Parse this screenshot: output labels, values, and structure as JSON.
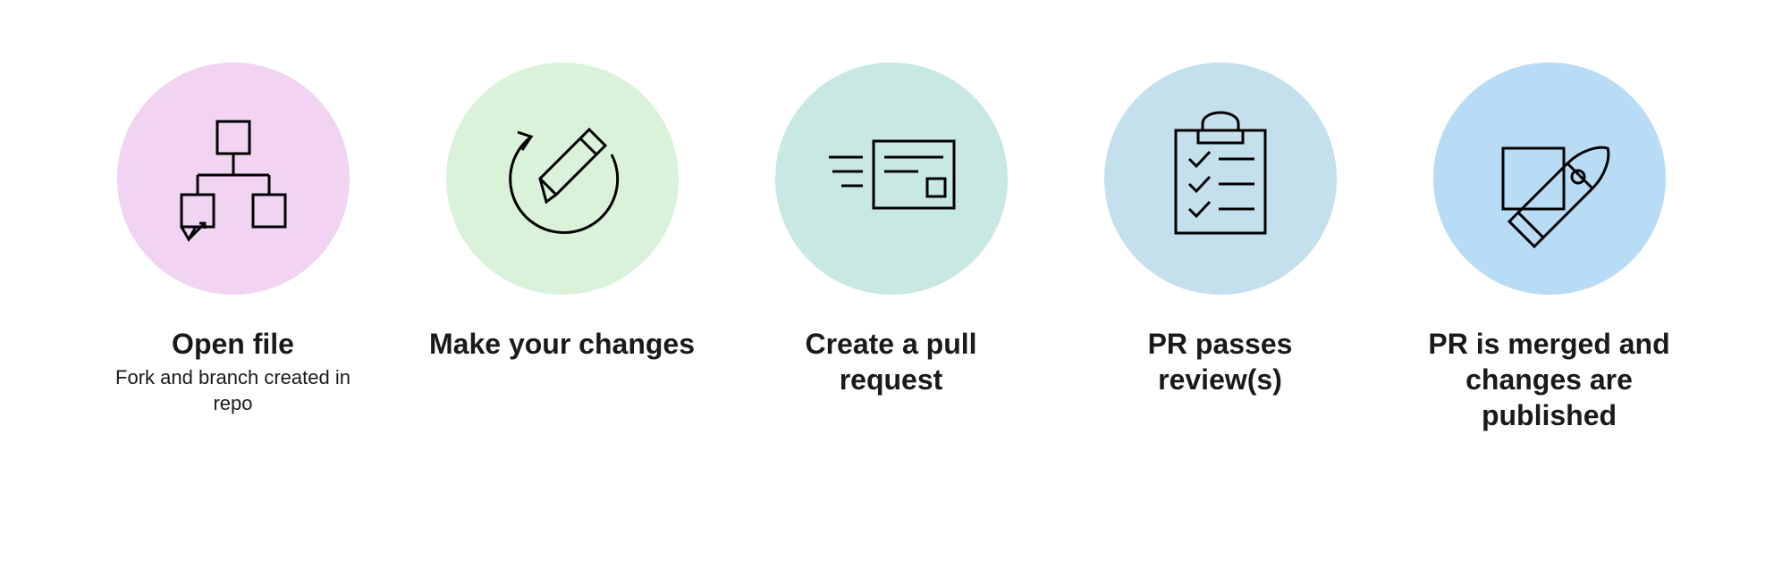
{
  "steps": [
    {
      "title": "Open file",
      "subtitle": "Fork and branch created in repo",
      "color": "#f1d3f2",
      "icon": "fork-tree-icon"
    },
    {
      "title": "Make your changes",
      "subtitle": "",
      "color": "#d9f2d9",
      "icon": "pencil-cycle-icon"
    },
    {
      "title": "Create a pull request",
      "subtitle": "",
      "color": "#c8e8e3",
      "icon": "form-submit-icon"
    },
    {
      "title": "PR passes review(s)",
      "subtitle": "",
      "color": "#c5e0ed",
      "icon": "clipboard-check-icon"
    },
    {
      "title": "PR is merged and changes are published",
      "subtitle": "",
      "color": "#b8dcf5",
      "icon": "rocket-launch-icon"
    }
  ]
}
